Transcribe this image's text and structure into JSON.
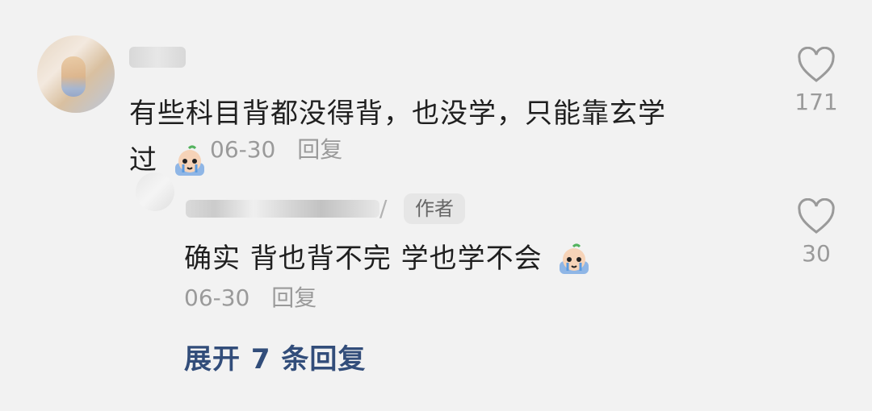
{
  "comments": [
    {
      "text_line1": "有些科目背都没得背，也没学，只能靠玄学",
      "text_line2": "过",
      "date": "06-30",
      "reply_label": "回复",
      "likes": "171",
      "emoji": "crying-face-emoji"
    }
  ],
  "reply": {
    "author_tag": "作者",
    "slash": "/",
    "text": "确实 背也背不完 学也学不会",
    "date": "06-30",
    "reply_label": "回复",
    "likes": "30",
    "emoji": "crying-face-emoji"
  },
  "expand_label": "展开 7 条回复",
  "icons": {
    "like": "heart-icon"
  },
  "colors": {
    "background": "#f2f2f2",
    "link": "#324d7a",
    "muted": "#9a9a9a"
  }
}
